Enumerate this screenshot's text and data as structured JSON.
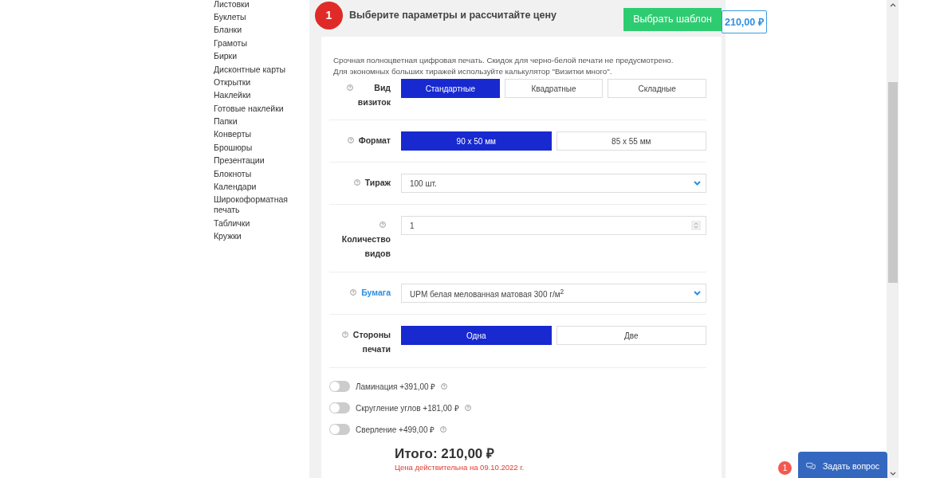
{
  "sidebar": {
    "items": [
      "Листовки",
      "Буклеты",
      "Бланки",
      "Грамоты",
      "Бирки",
      "Дисконтные карты",
      "Открытки",
      "Наклейки",
      "Готовые наклейки",
      "Папки",
      "Конверты",
      "Брошюры",
      "Презентации",
      "Блокноты",
      "Календари",
      "Широкоформатная печать",
      "Таблички",
      "Кружки"
    ]
  },
  "step": {
    "number": "1",
    "title": "Выберите параметры и рассчитайте цену",
    "template_button": "Выбрать шаблон",
    "price": "210,00 ₽"
  },
  "description": [
    "Срочная полноцветная цифровая печать. Скидок для черно-белой печати не предусмотрено.",
    "Для экономных больших тиражей используйте калькулятор \"Визитки много\"."
  ],
  "fields": [
    {
      "kind": "segmented",
      "label": "Вид визиток",
      "link": false,
      "options": [
        {
          "label": "Стандартные",
          "selected": true
        },
        {
          "label": "Квадратные",
          "selected": false
        },
        {
          "label": "Складные",
          "selected": false
        }
      ]
    },
    {
      "kind": "segmented",
      "label": "Формат",
      "link": false,
      "options": [
        {
          "label": "90 x 50 мм",
          "selected": true
        },
        {
          "label": "85 x 55 мм",
          "selected": false
        }
      ]
    },
    {
      "kind": "select",
      "label": "Тираж",
      "link": false,
      "value": "100 шт."
    },
    {
      "kind": "number",
      "label": "Количество видов",
      "link": false,
      "value": "1"
    },
    {
      "kind": "select",
      "label": "Бумага",
      "link": true,
      "value": "UPM белая мелованная матовая 300 г/м$^{2}$"
    },
    {
      "kind": "segmented",
      "label": "Стороны печати",
      "link": false,
      "options": [
        {
          "label": "Одна",
          "selected": true
        },
        {
          "label": "Две",
          "selected": false
        }
      ]
    }
  ],
  "extras": [
    {
      "label": "Ламинация +391,00 ₽",
      "on": false
    },
    {
      "label": "Скругление углов +181,00 ₽",
      "on": false
    },
    {
      "label": "Сверление +499,00 ₽",
      "on": false
    }
  ],
  "total": "Итого: 210,00 ₽",
  "valid_note": "Цена действительна на 09.10.2022 г.",
  "chat": {
    "badge": "1",
    "label": "Задать вопрос"
  }
}
